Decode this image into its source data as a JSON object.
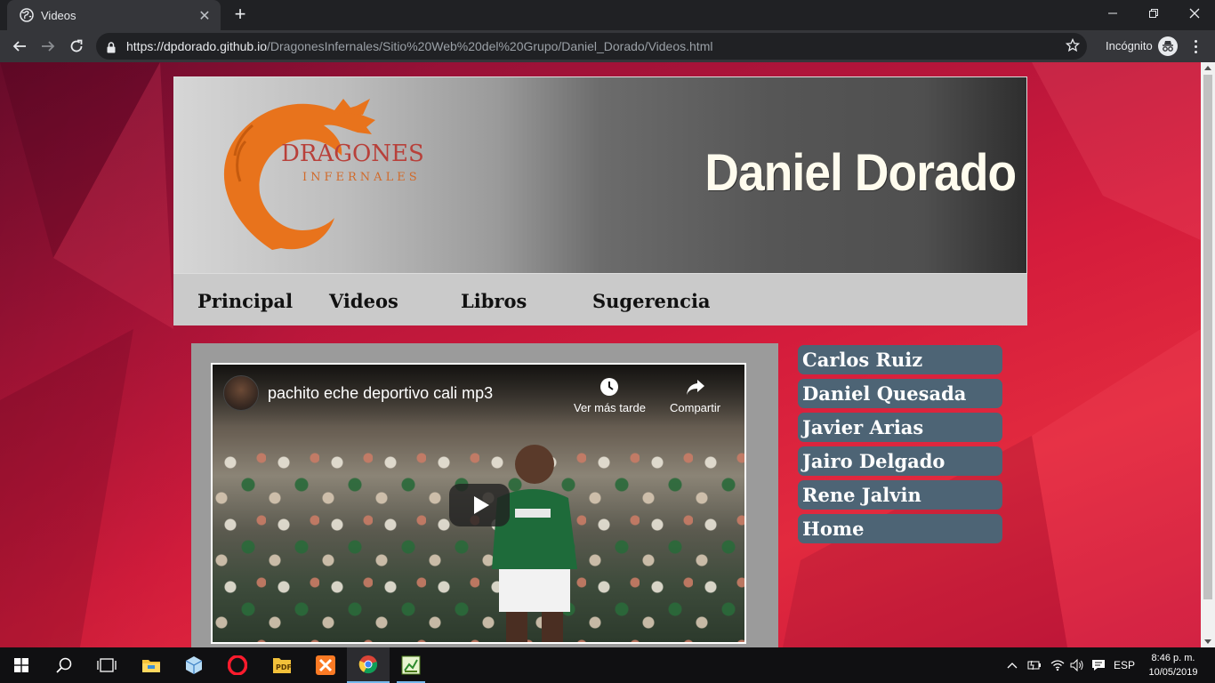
{
  "browser": {
    "tab_title": "Videos",
    "url_host": "https://dpdorado.github.io",
    "url_path": "/DragonesInfernales/Sitio%20Web%20del%20Grupo/Daniel_Dorado/Videos.html",
    "incognito_label": "Incógnito",
    "new_tab_symbol": "+",
    "close_tab_symbol": "✕"
  },
  "header": {
    "logo_word1": "DRAGONES",
    "logo_word2": "INFERNALES",
    "site_name": "Daniel Dorado"
  },
  "nav": {
    "items": [
      "Principal",
      "Videos",
      "Libros",
      "Sugerencia"
    ]
  },
  "video": {
    "title": "pachito eche deportivo cali mp3",
    "watch_later_label": "Ver más tarde",
    "share_label": "Compartir"
  },
  "sidenav": {
    "items": [
      "Carlos Ruiz",
      "Daniel Quesada",
      "Javier Arias",
      "Jairo Delgado",
      "Rene Jalvin",
      "Home"
    ]
  },
  "taskbar": {
    "language": "ESP",
    "time": "8:46 p. m.",
    "date": "10/05/2019"
  },
  "colors": {
    "page_background": "#c9163b",
    "side_button": "#4d6475",
    "navbar": "#cacaca",
    "logo_orange": "#e8731c"
  }
}
